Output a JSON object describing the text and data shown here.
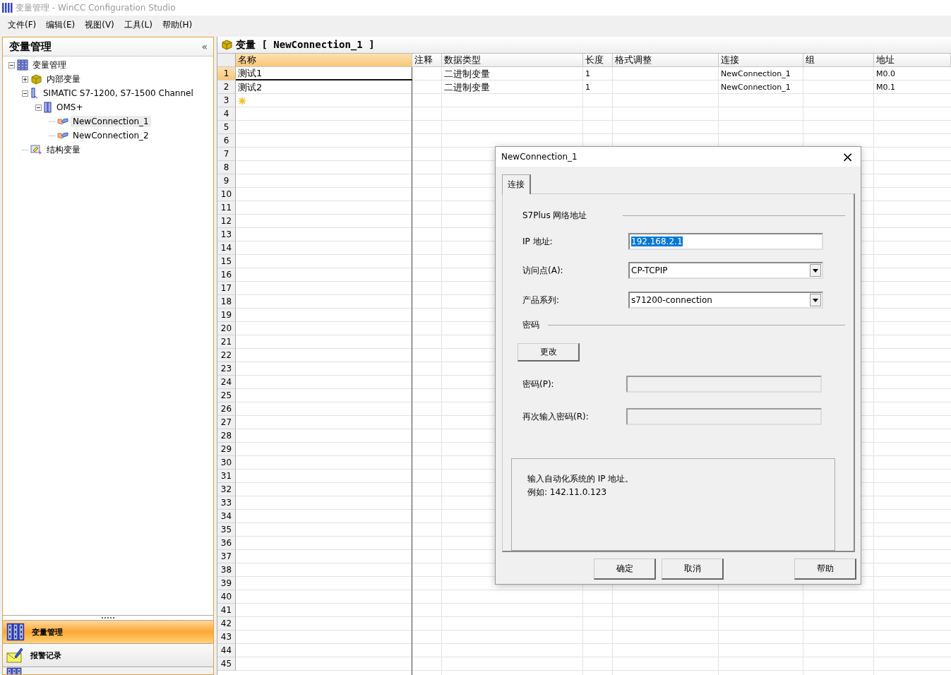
{
  "window": {
    "title": "变量管理 - WinCC Configuration Studio"
  },
  "menu": [
    "文件(F)",
    "编辑(E)",
    "视图(V)",
    "工具(L)",
    "帮助(H)"
  ],
  "sidebar": {
    "title": "变量管理",
    "collapse": "«",
    "tree": [
      {
        "label": "变量管理",
        "kind": "tags",
        "expanded": true,
        "selected": false,
        "children": [
          {
            "label": "内部变量",
            "kind": "internal",
            "expanded": false,
            "selected": false
          },
          {
            "label": "SIMATIC S7-1200, S7-1500 Channel",
            "kind": "channel",
            "expanded": true,
            "selected": false,
            "children": [
              {
                "label": "OMS+",
                "kind": "unit",
                "expanded": true,
                "selected": false,
                "children": [
                  {
                    "label": "NewConnection_1",
                    "kind": "connection",
                    "selected": true
                  },
                  {
                    "label": "NewConnection_2",
                    "kind": "connection",
                    "selected": false
                  }
                ]
              }
            ]
          },
          {
            "label": "结构变量",
            "kind": "struct",
            "selected": false
          }
        ]
      }
    ],
    "nav_items": [
      {
        "label": "变量管理",
        "kind": "tags",
        "selected": true
      },
      {
        "label": "报警记录",
        "kind": "alarm",
        "selected": false
      }
    ]
  },
  "editor": {
    "title": "变量 [ NewConnection_1 ]",
    "columns": [
      {
        "label": "名称",
        "selected": true
      },
      {
        "label": "注释",
        "selected": false
      },
      {
        "label": "数据类型",
        "selected": false
      },
      {
        "label": "长度",
        "selected": false
      },
      {
        "label": "格式调整",
        "selected": false
      },
      {
        "label": "连接",
        "selected": false
      },
      {
        "label": "组",
        "selected": false
      },
      {
        "label": "地址",
        "selected": false
      }
    ],
    "rows": [
      {
        "number": "1",
        "kind": "data",
        "selected": true,
        "cells": [
          "测试1",
          "",
          "二进制变量",
          "1",
          "",
          "NewConnection_1",
          "",
          "M0.0"
        ]
      },
      {
        "number": "2",
        "kind": "data",
        "selected": false,
        "cells": [
          "测试2",
          "",
          "二进制变量",
          "1",
          "",
          "NewConnection_1",
          "",
          "M0.1"
        ]
      },
      {
        "number": "3",
        "kind": "new",
        "selected": false
      },
      {
        "number": "4",
        "kind": "empty",
        "selected": false
      },
      {
        "number": "5",
        "kind": "empty",
        "selected": false
      },
      {
        "number": "6",
        "kind": "empty",
        "selected": false
      },
      {
        "number": "7",
        "kind": "empty",
        "selected": false
      },
      {
        "number": "8",
        "kind": "empty",
        "selected": false
      },
      {
        "number": "9",
        "kind": "empty",
        "selected": false
      },
      {
        "number": "10",
        "kind": "empty",
        "selected": false
      },
      {
        "number": "11",
        "kind": "empty",
        "selected": false
      },
      {
        "number": "12",
        "kind": "empty",
        "selected": false
      },
      {
        "number": "13",
        "kind": "empty",
        "selected": false
      },
      {
        "number": "14",
        "kind": "empty",
        "selected": false
      },
      {
        "number": "15",
        "kind": "empty",
        "selected": false
      },
      {
        "number": "16",
        "kind": "empty",
        "selected": false
      },
      {
        "number": "17",
        "kind": "empty",
        "selected": false
      },
      {
        "number": "18",
        "kind": "empty",
        "selected": false
      },
      {
        "number": "19",
        "kind": "empty",
        "selected": false
      },
      {
        "number": "20",
        "kind": "empty",
        "selected": false
      },
      {
        "number": "21",
        "kind": "empty",
        "selected": false
      },
      {
        "number": "22",
        "kind": "empty",
        "selected": false
      },
      {
        "number": "23",
        "kind": "empty",
        "selected": false
      },
      {
        "number": "24",
        "kind": "empty",
        "selected": false
      },
      {
        "number": "25",
        "kind": "empty",
        "selected": false
      },
      {
        "number": "26",
        "kind": "empty",
        "selected": false
      },
      {
        "number": "27",
        "kind": "empty",
        "selected": false
      },
      {
        "number": "28",
        "kind": "empty",
        "selected": false
      },
      {
        "number": "29",
        "kind": "empty",
        "selected": false
      },
      {
        "number": "30",
        "kind": "empty",
        "selected": false
      },
      {
        "number": "31",
        "kind": "empty",
        "selected": false
      },
      {
        "number": "32",
        "kind": "empty",
        "selected": false
      },
      {
        "number": "33",
        "kind": "empty",
        "selected": false
      },
      {
        "number": "34",
        "kind": "empty",
        "selected": false
      },
      {
        "number": "35",
        "kind": "empty",
        "selected": false
      },
      {
        "number": "36",
        "kind": "empty",
        "selected": false
      },
      {
        "number": "37",
        "kind": "empty",
        "selected": false
      },
      {
        "number": "38",
        "kind": "empty",
        "selected": false
      },
      {
        "number": "39",
        "kind": "empty",
        "selected": false
      },
      {
        "number": "40",
        "kind": "empty",
        "selected": false
      },
      {
        "number": "41",
        "kind": "empty",
        "selected": false
      },
      {
        "number": "42",
        "kind": "empty",
        "selected": false
      },
      {
        "number": "43",
        "kind": "empty",
        "selected": false
      },
      {
        "number": "44",
        "kind": "empty",
        "selected": false
      },
      {
        "number": "45",
        "kind": "empty",
        "selected": false
      }
    ]
  },
  "dialog": {
    "title": "NewConnection_1",
    "close": "×",
    "tabs": [
      {
        "label": "连接",
        "selected": true
      }
    ],
    "sections": [
      {
        "heading": "S7Plus 网络地址",
        "items": [
          {
            "kind": "text",
            "label": "IP 地址:",
            "value": "192.168.2.1",
            "text_selected": true
          },
          {
            "kind": "dropdown",
            "label": "访问点(A):",
            "value": "CP-TCPIP"
          },
          {
            "kind": "dropdown",
            "label": "产品系列:",
            "value": "s71200-connection"
          }
        ]
      },
      {
        "heading": "密码",
        "items": [
          {
            "kind": "button",
            "label": "更改"
          },
          {
            "kind": "password",
            "label": "密码(P):",
            "disabled": true
          },
          {
            "kind": "password",
            "label": "再次输入密码(R):",
            "disabled": true
          }
        ]
      }
    ],
    "hint": [
      "输入自动化系统的 IP 地址。",
      "例如: 142.11.0.123"
    ],
    "buttons": [
      "确定",
      "取消",
      "帮助"
    ]
  }
}
